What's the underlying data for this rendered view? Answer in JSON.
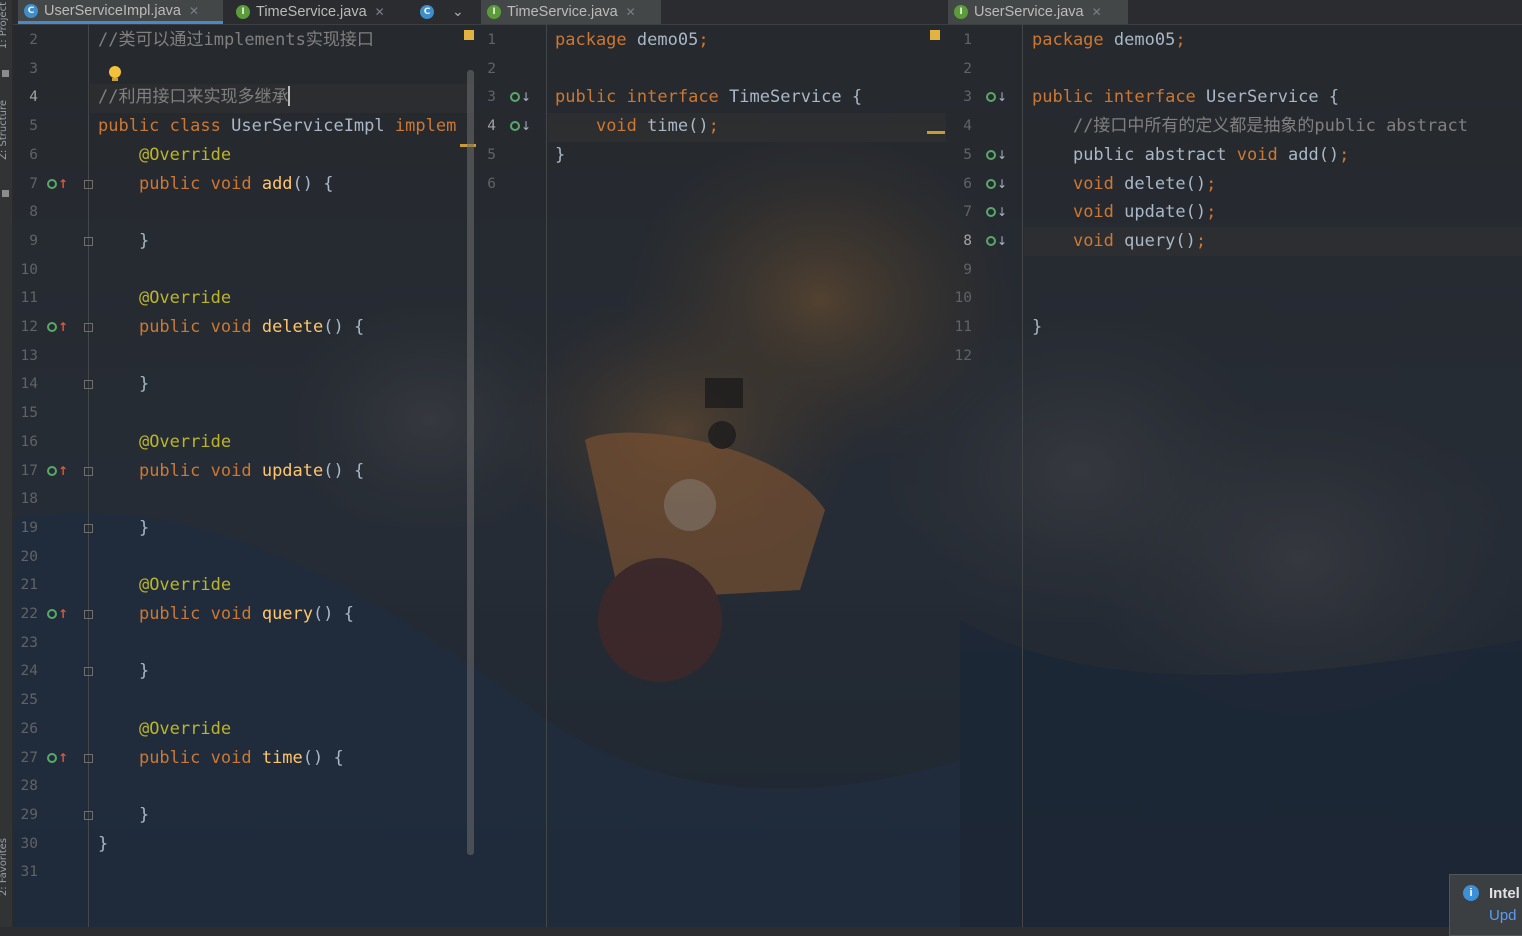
{
  "sidebar": {
    "project_label": "1: Project",
    "structure_label": "Z: Structure",
    "favorites_label": "2: Favorites"
  },
  "panes": [
    {
      "tabs": [
        {
          "icon": "C",
          "name": "UserServiceImpl.java",
          "active": true
        },
        {
          "icon": "I",
          "name": "TimeService.java",
          "active": false
        }
      ],
      "lines": [
        {
          "n": "2"
        },
        {
          "n": "3"
        },
        {
          "n": "4"
        },
        {
          "n": "5"
        },
        {
          "n": "6"
        },
        {
          "n": "7"
        },
        {
          "n": "8"
        },
        {
          "n": "9"
        },
        {
          "n": "10"
        },
        {
          "n": "11"
        },
        {
          "n": "12"
        },
        {
          "n": "13"
        },
        {
          "n": "14"
        },
        {
          "n": "15"
        },
        {
          "n": "16"
        },
        {
          "n": "17"
        },
        {
          "n": "18"
        },
        {
          "n": "19"
        },
        {
          "n": "20"
        },
        {
          "n": "21"
        },
        {
          "n": "22"
        },
        {
          "n": "23"
        },
        {
          "n": "24"
        },
        {
          "n": "25"
        },
        {
          "n": "26"
        },
        {
          "n": "27"
        },
        {
          "n": "28"
        },
        {
          "n": "29"
        },
        {
          "n": "30"
        },
        {
          "n": "31"
        }
      ],
      "code": {
        "l2": "//类可以通过implements实现接口",
        "l4": "//利用接口来实现多继承",
        "l5_kw1": "public",
        "l5_kw2": "class",
        "l5_name": "UserServiceImpl",
        "l5_kw3": "implem",
        "override": "@Override",
        "public": "public",
        "void": "void",
        "m_add": "add",
        "m_delete": "delete",
        "m_update": "update",
        "m_query": "query",
        "m_time": "time",
        "sig_end": "() {",
        "close": "}"
      }
    },
    {
      "tabs": [
        {
          "icon": "I",
          "name": "TimeService.java",
          "active": false
        }
      ],
      "lines": [
        {
          "n": "1"
        },
        {
          "n": "2"
        },
        {
          "n": "3"
        },
        {
          "n": "4"
        },
        {
          "n": "5"
        },
        {
          "n": "6"
        }
      ],
      "code": {
        "package_kw": "package",
        "package_name": "demo05",
        "semi": ";",
        "public": "public",
        "interface": "interface",
        "name": "TimeService",
        "brace": "{",
        "void": "void",
        "m_time": "time",
        "call": "()",
        "close": "}"
      }
    },
    {
      "tabs": [
        {
          "icon": "I",
          "name": "UserService.java",
          "active": false
        }
      ],
      "lines": [
        {
          "n": "1"
        },
        {
          "n": "2"
        },
        {
          "n": "3"
        },
        {
          "n": "4"
        },
        {
          "n": "5"
        },
        {
          "n": "6"
        },
        {
          "n": "7"
        },
        {
          "n": "8"
        },
        {
          "n": "9"
        },
        {
          "n": "10"
        },
        {
          "n": "11"
        },
        {
          "n": "12"
        }
      ],
      "code": {
        "package_kw": "package",
        "package_name": "demo05",
        "semi": ";",
        "public": "public",
        "interface": "interface",
        "name": "UserService",
        "brace": "{",
        "comment": "//接口中所有的定义都是抽象的public abstract",
        "abstract": "abstract",
        "void": "void",
        "m_add": "add",
        "m_delete": "delete",
        "m_update": "update",
        "m_query": "query",
        "call": "()",
        "close": "}"
      }
    }
  ],
  "notification": {
    "title": "Intel",
    "link": "Upd"
  },
  "colors": {
    "keyword": "#cc7832",
    "annotation": "#bbb529",
    "method": "#ffc66d",
    "comment": "#808080",
    "text": "#a9b7c6"
  }
}
